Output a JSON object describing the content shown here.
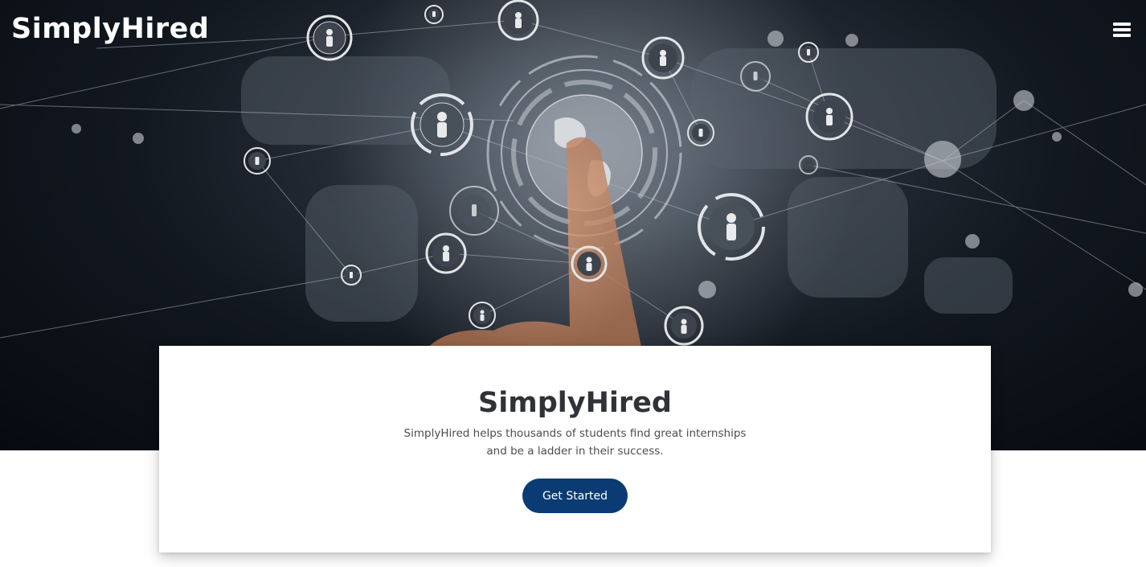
{
  "header": {
    "logo_text": "SimplyHired",
    "menu_icon": "hamburger-menu-icon"
  },
  "hero": {
    "background": "network-globe-illustration",
    "accent_color": "#0a3b73"
  },
  "card": {
    "title": "SimplyHired",
    "description": "SimplyHired helps thousands of students find great internships and be a ladder in their success.",
    "cta_label": "Get Started"
  }
}
